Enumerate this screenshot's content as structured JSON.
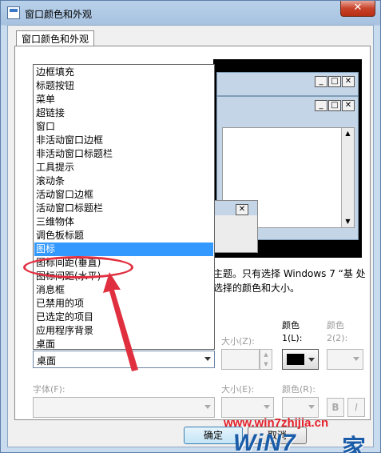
{
  "window": {
    "title": "窗口颜色和外观",
    "close_glyph": "✕"
  },
  "tab": {
    "label": "窗口颜色和外观"
  },
  "preview": {
    "btn_min": "_",
    "btn_max": "□",
    "btn_close": "✕",
    "scroll_up": "▲",
    "scroll_down": "▼"
  },
  "description": "主题。只有选择 Windows 7 “基 处选择的颜色和大小。",
  "item_dropdown": {
    "items": [
      "边框填充",
      "标题按钮",
      "菜单",
      "超链接",
      "窗口",
      "非活动窗口边框",
      "非活动窗口标题栏",
      "工具提示",
      "滚动条",
      "活动窗口边框",
      "活动窗口标题栏",
      "三维物体",
      "调色板标题",
      "图标",
      "图标间距(垂直)",
      "图标间距(水平)",
      "消息框",
      "已禁用的项",
      "已选定的项目",
      "应用程序背景",
      "桌面"
    ],
    "selected": "图标",
    "selected_index": 13,
    "current_value": "桌面"
  },
  "item_settings": {
    "size_label": "大小(Z):",
    "color1_label_a": "颜色",
    "color1_label_b": "1(L):",
    "color2_label_a": "颜色",
    "color2_label_b": "2(2):",
    "color1_value": "#000000"
  },
  "font_settings": {
    "font_label": "字体(F):",
    "size_label": "大小(E):",
    "color_label": "颜色(R):",
    "bold": "B",
    "italic": "I"
  },
  "buttons": {
    "ok": "确定",
    "cancel": "取消"
  },
  "watermark": {
    "url": "www.win7zhijia.cn",
    "logo": "WiN7",
    "jia": "家"
  },
  "colors": {
    "selection": "#3399ff",
    "annotation": "#e03040"
  }
}
